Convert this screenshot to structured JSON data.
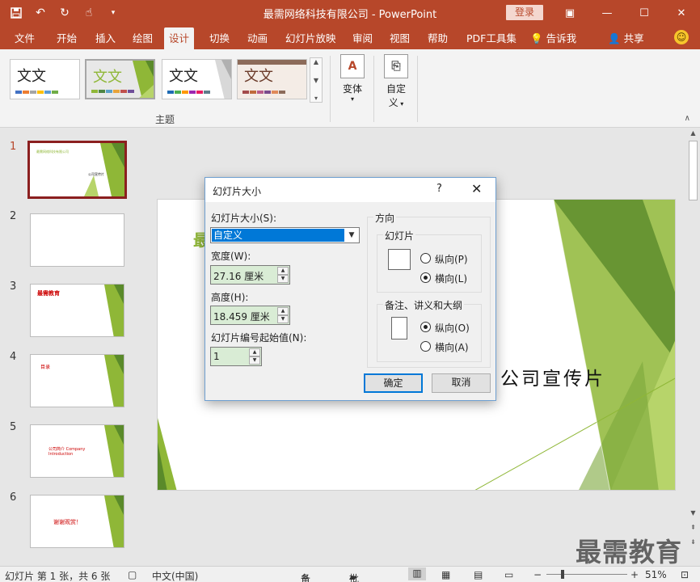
{
  "window": {
    "title": "最需网络科技有限公司 - PowerPoint",
    "login_label": "登录"
  },
  "quick_access": [
    "save-icon",
    "undo-icon",
    "redo-icon",
    "touch-mode-icon",
    "customize-icon"
  ],
  "tabs": [
    "文件",
    "开始",
    "插入",
    "绘图",
    "设计",
    "切换",
    "动画",
    "幻灯片放映",
    "审阅",
    "视图",
    "帮助",
    "PDF工具集"
  ],
  "active_tab": "设计",
  "tell_me": "告诉我",
  "share": "共享",
  "ribbon": {
    "theme_sample": "文文",
    "themes_group_label": "主题",
    "variants_label": "变体",
    "customize_label_1": "自定",
    "customize_label_2": "义"
  },
  "thumbnails": [
    {
      "num": "1",
      "text": "最需网络科技有限公司 · 公司宣传片"
    },
    {
      "num": "2",
      "text": ""
    },
    {
      "num": "3",
      "text": "最需教育"
    },
    {
      "num": "4",
      "text": "目录"
    },
    {
      "num": "5",
      "text": "公司简介 Company Introduction"
    },
    {
      "num": "6",
      "text": "谢谢观赏！"
    }
  ],
  "slide": {
    "title_fragment": "最",
    "subtitle": "公司宣传片"
  },
  "dialog": {
    "title": "幻灯片大小",
    "help": "?",
    "size_label": "幻灯片大小(S):",
    "size_value": "自定义",
    "width_label": "宽度(W):",
    "width_value": "27.16 厘米",
    "height_label": "高度(H):",
    "height_value": "18.459 厘米",
    "start_label": "幻灯片编号起始值(N):",
    "start_value": "1",
    "orientation_label": "方向",
    "slides_label": "幻灯片",
    "portrait_label": "纵向(P)",
    "landscape_label": "横向(L)",
    "notes_label": "备注、讲义和大纲",
    "notes_portrait_label": "纵向(O)",
    "notes_landscape_label": "横向(A)",
    "slides_orientation": "landscape",
    "notes_orientation": "portrait",
    "ok_label": "确定",
    "cancel_label": "取消"
  },
  "status": {
    "slide_info": "幻灯片 第 1 张，共 6 张",
    "language": "中文(中国)",
    "notes": "备注",
    "comments": "批注",
    "zoom": "51%"
  },
  "watermark": "最需教育",
  "colors": {
    "accent": "#b7472a",
    "theme_green": "#8fb737",
    "selection_blue": "#0078d7"
  }
}
